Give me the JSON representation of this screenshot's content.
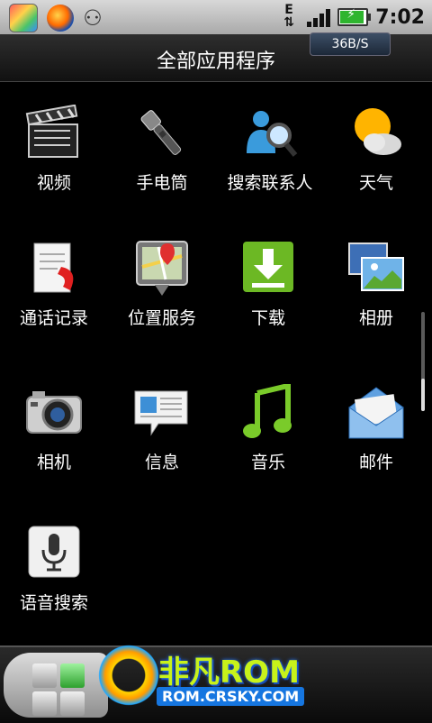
{
  "status_bar": {
    "left_icons": [
      "market-icon",
      "sd-card-icon",
      "usb-icon"
    ],
    "network": "E",
    "time": "7:02"
  },
  "title_bar": {
    "title": "全部应用程序",
    "speed_badge": "36B/S"
  },
  "apps": [
    {
      "label": "视频",
      "icon": "clapperboard-icon"
    },
    {
      "label": "手电筒",
      "icon": "flashlight-icon"
    },
    {
      "label": "搜索联系人",
      "icon": "contact-search-icon"
    },
    {
      "label": "天气",
      "icon": "weather-icon"
    },
    {
      "label": "通话记录",
      "icon": "call-log-icon"
    },
    {
      "label": "位置服务",
      "icon": "map-pin-icon"
    },
    {
      "label": "下载",
      "icon": "download-icon"
    },
    {
      "label": "相册",
      "icon": "gallery-icon"
    },
    {
      "label": "相机",
      "icon": "camera-icon"
    },
    {
      "label": "信息",
      "icon": "message-icon"
    },
    {
      "label": "音乐",
      "icon": "music-note-icon"
    },
    {
      "label": "邮件",
      "icon": "mail-icon"
    },
    {
      "label": "语音搜索",
      "icon": "microphone-icon"
    }
  ],
  "watermark": {
    "title": "非凡ROM",
    "subtitle": "ROM.CRSKY.COM"
  },
  "colors": {
    "background": "#000000",
    "accent_green": "#2ea02e"
  }
}
